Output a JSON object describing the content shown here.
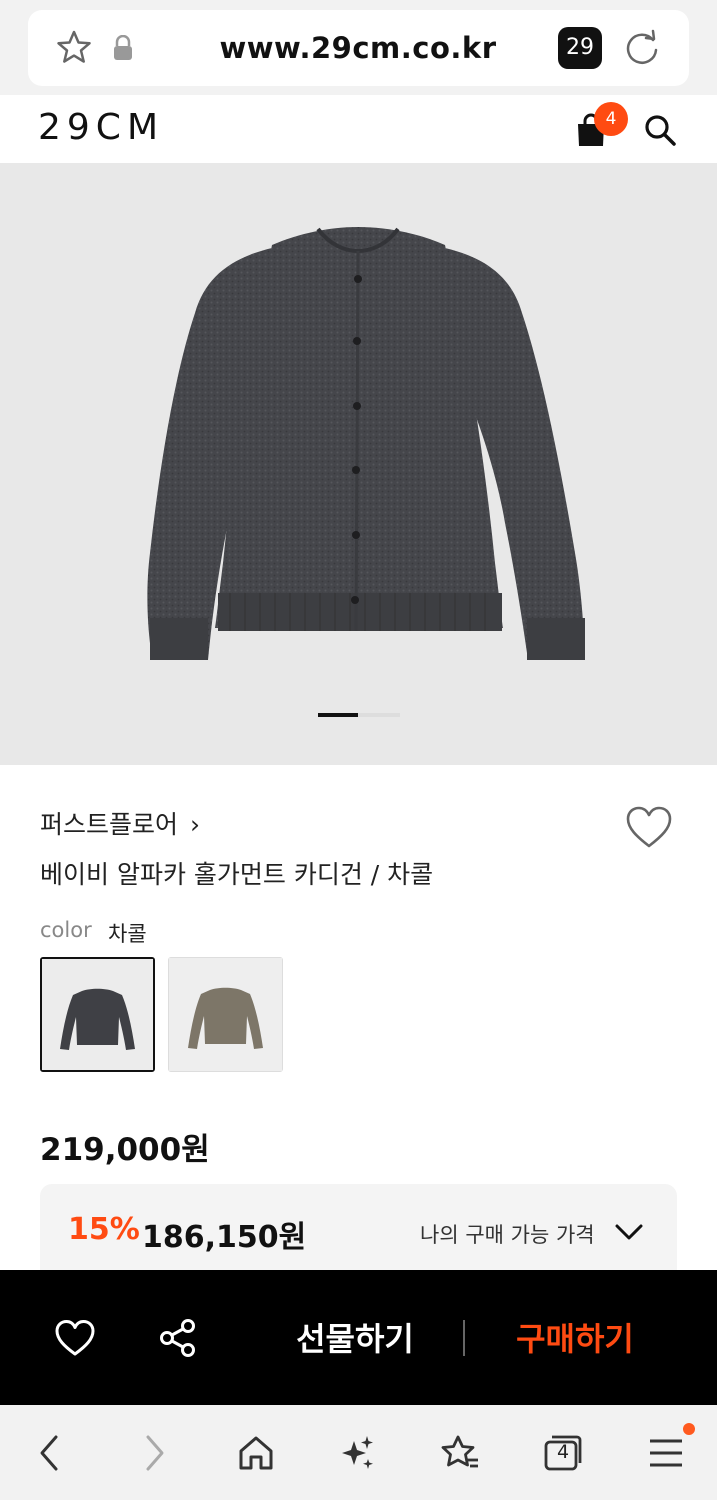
{
  "browser": {
    "url": "www.29cm.co.kr",
    "tab_count": "29",
    "icons": [
      "star-icon",
      "lock-icon",
      "reload-icon"
    ]
  },
  "header": {
    "logo": "29CM",
    "cart_count": "4",
    "icons": [
      "cart-icon",
      "search-icon"
    ]
  },
  "product": {
    "brand": "퍼스트플로어",
    "brand_chevron": "›",
    "name": "베이비 알파카 홀가먼트 카디건 / 차콜",
    "color_label": "color",
    "color_value": "차콜",
    "swatches": [
      {
        "name": "차콜",
        "color": "#3f4045",
        "selected": true
      },
      {
        "name": "khaki",
        "color": "#7d7668",
        "selected": false
      }
    ],
    "image_pager": {
      "current": 1,
      "total": 2
    },
    "price": "219,000원",
    "discount_percent": "15%",
    "discount_price": "186,150원",
    "my_price_label": "나의 구매 가능 가격"
  },
  "actions": {
    "gift_label": "선물하기",
    "buy_label": "구매하기",
    "icons": [
      "heart-icon",
      "share-icon"
    ]
  },
  "bottom_nav": {
    "tabs_count": "4",
    "icons": [
      "back-icon",
      "forward-icon",
      "home-icon",
      "sparkle-icon",
      "bookmarks-icon",
      "tabs-icon",
      "menu-icon"
    ]
  },
  "colors": {
    "accent": "#ff4b12",
    "dark": "#111111",
    "hero_bg": "#e8e8e8"
  }
}
